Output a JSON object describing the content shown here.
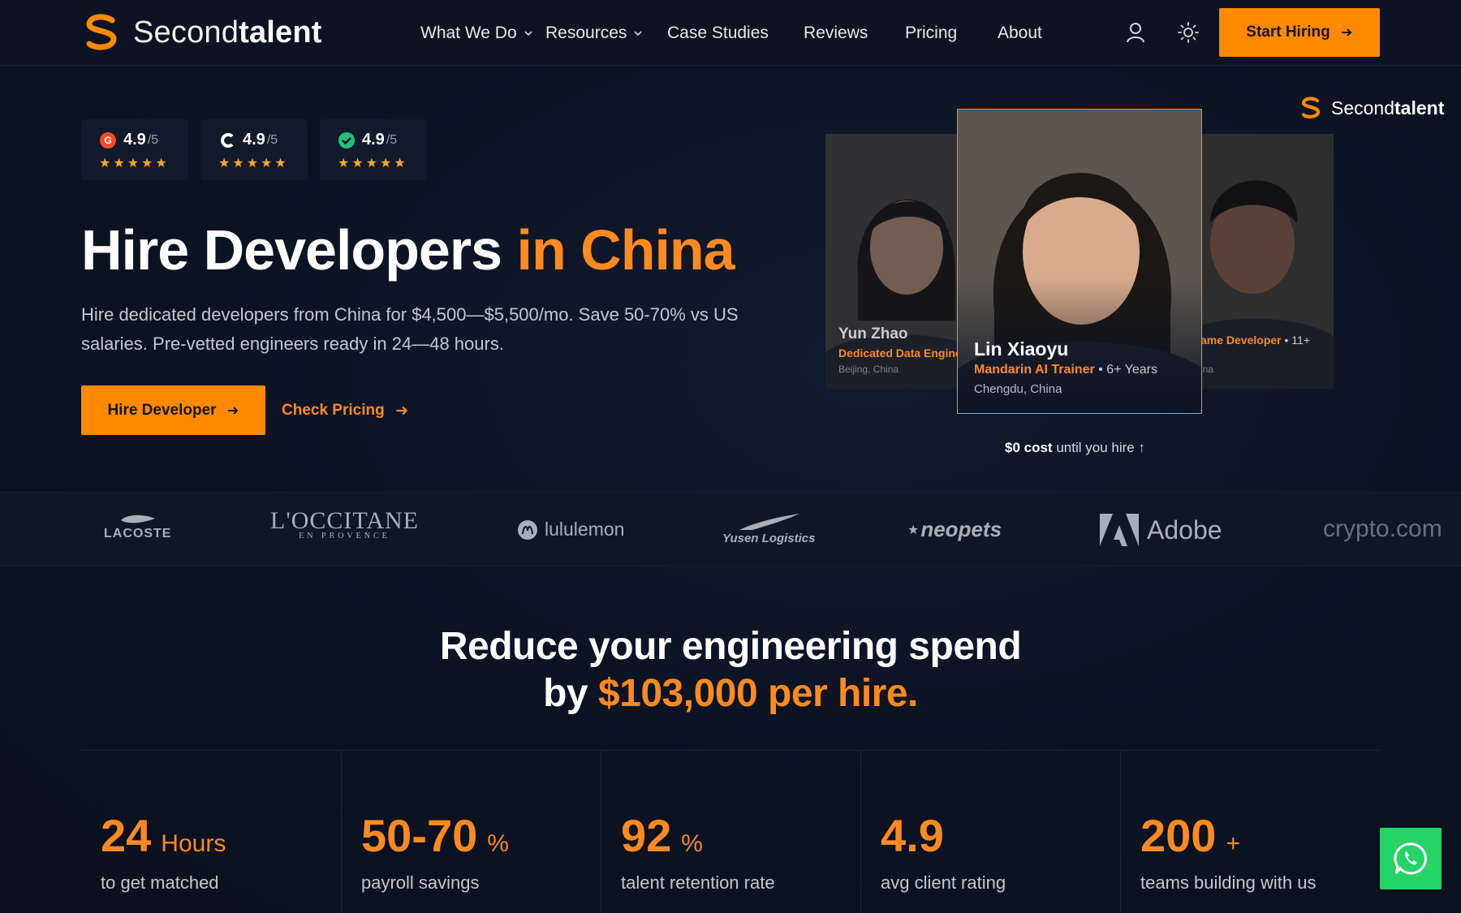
{
  "brand": {
    "name_light": "Second",
    "name_bold": "talent"
  },
  "nav": {
    "items": [
      {
        "label": "What We Do",
        "has_dropdown": true
      },
      {
        "label": "Resources",
        "has_dropdown": true
      },
      {
        "label": "Case Studies"
      },
      {
        "label": "Reviews"
      },
      {
        "label": "Pricing"
      },
      {
        "label": "About"
      }
    ],
    "cta_label": "Start Hiring"
  },
  "ratings": [
    {
      "source": "G2",
      "score": "4.9",
      "out_of": "/5",
      "stars": "★★★★★",
      "icon_color": "#ff492c"
    },
    {
      "source": "Capterra",
      "score": "4.9",
      "out_of": "/5",
      "stars": "★★★★★",
      "icon_color": "#ffffff"
    },
    {
      "source": "Trusted",
      "score": "4.9",
      "out_of": "/5",
      "stars": "★★★★★",
      "icon_color": "#22c07a"
    }
  ],
  "hero": {
    "title_white": "Hire Developers",
    "title_orange": "in China",
    "subtitle": "Hire dedicated developers from China for $4,500—$5,500/mo. Save 50-70% vs US salaries. Pre-vetted engineers ready in 24—48 hours.",
    "primary_cta": "Hire Developer",
    "secondary_cta": "Check Pricing"
  },
  "profiles": {
    "left": {
      "name": "Yun Zhao",
      "role": "Dedicated Data Enginee",
      "location": "Beijing, China"
    },
    "main": {
      "name": "Lin Xiaoyu",
      "role": "Mandarin AI Trainer",
      "years": " • 6+ Years",
      "location": "Chengdu, China"
    },
    "right": {
      "role": "ame Developer",
      "years": " • 11+",
      "location": "ina"
    }
  },
  "watermark": {
    "name_light": "Second",
    "name_bold": "talent"
  },
  "cost_note": {
    "bold": "$0 cost",
    "rest": "until you hire ↑"
  },
  "clients": [
    "LACOSTE",
    "L'OCCITANE",
    "EN PROVENCE",
    "lululemon",
    "Yusen Logistics",
    "neopets",
    "Adobe",
    "crypto.com"
  ],
  "reduce": {
    "line1": "Reduce your engineering spend",
    "line2_white": "by",
    "line2_orange": "$103,000 per hire."
  },
  "stats": [
    {
      "value": "24",
      "unit": "Hours",
      "label": "to get matched"
    },
    {
      "value": "50-70",
      "unit": "%",
      "label": "payroll savings"
    },
    {
      "value": "92",
      "unit": "%",
      "label": "talent retention rate"
    },
    {
      "value": "4.9",
      "unit": "",
      "label": "avg client rating"
    },
    {
      "value": "200",
      "unit": "+",
      "label": "teams building with us"
    }
  ],
  "colors": {
    "accent": "#ff8a00",
    "background": "#0b1222",
    "whatsapp": "#25d366"
  }
}
